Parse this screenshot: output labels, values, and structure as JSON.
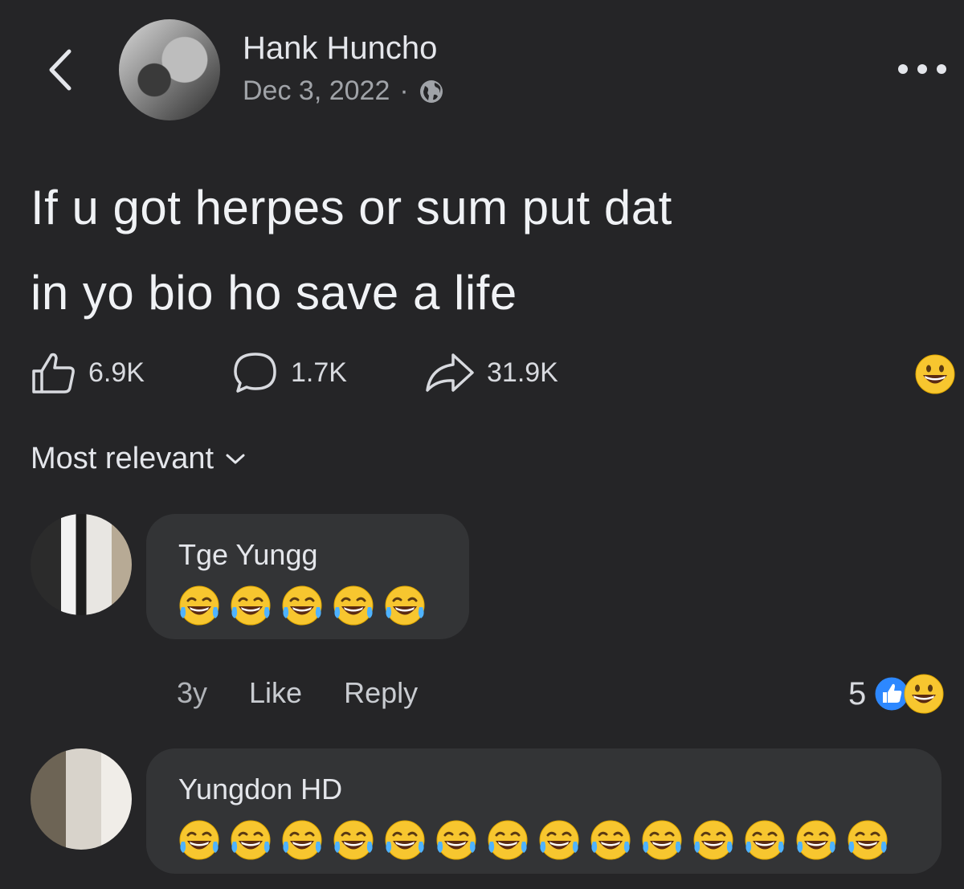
{
  "post": {
    "author": "Hank Huncho",
    "date": "Dec 3, 2022",
    "separator": "·",
    "text_line1": "If u got herpes or sum put dat",
    "text_line2": "in yo bio ho save a life",
    "likes": "6.9K",
    "comments": "1.7K",
    "shares": "31.9K"
  },
  "sort": {
    "label": "Most relevant"
  },
  "comments": [
    {
      "author": "Tge Yungg",
      "emoji_count": 5,
      "age": "3y",
      "like_label": "Like",
      "reply_label": "Reply",
      "reaction_count": "5"
    },
    {
      "author": "Yungdon HD",
      "emoji_count": 14
    }
  ],
  "icons": [
    "back-chevron-icon",
    "globe-icon",
    "more-dots-icon",
    "like-icon",
    "comment-icon",
    "share-icon",
    "grin-emoji-icon",
    "laughing-emoji-icon",
    "thumb-reaction-icon"
  ],
  "colors": {
    "background": "#252527",
    "bubble": "#333436",
    "text": "#e4e6eb",
    "muted": "#a0a3a8",
    "like_blue": "#2d88ff",
    "emoji_yellow": "#f7c62f"
  }
}
